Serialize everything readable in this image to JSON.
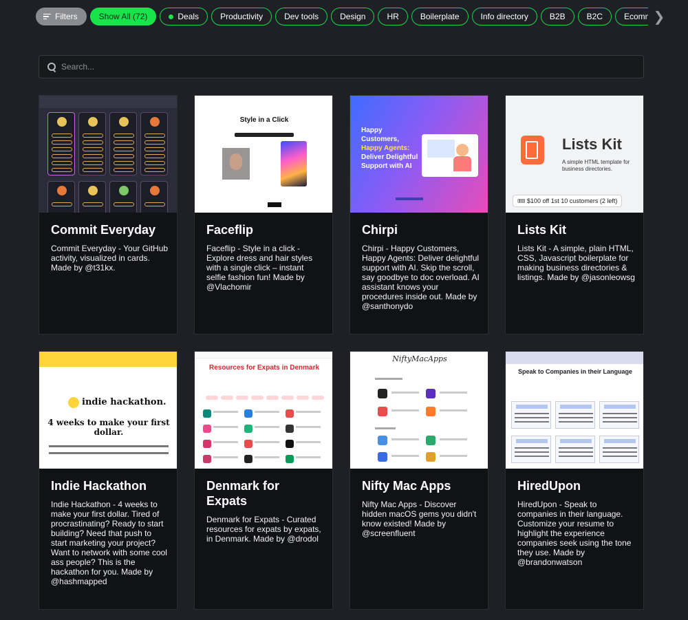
{
  "filters": {
    "filters_label": "Filters",
    "show_all_label": "Show All (72)",
    "categories": [
      "Deals",
      "Productivity",
      "Dev tools",
      "Design",
      "HR",
      "Boilerplate",
      "Info directory",
      "B2B",
      "B2C",
      "Ecommerce"
    ]
  },
  "search": {
    "placeholder": "Search..."
  },
  "cards": [
    {
      "title": "Commit Everyday",
      "description": "Commit Everyday - Your GitHub activity, visualized in cards. Made by @t31kx."
    },
    {
      "title": "Faceflip",
      "description": "Faceflip - Style in a click - Explore dress and hair styles with a single click – instant selfie fashion fun! Made by @Vlachomir",
      "thumb_heading": "Style in a Click"
    },
    {
      "title": "Chirpi",
      "description": "Chirpi - Happy Customers, Happy Agents: Deliver delightful support with AI. Skip the scroll, say goodbye to doc overload. AI assistant knows your procedures inside out. Made by @santhonydo",
      "thumb_text": [
        "Happy",
        "Customers,",
        "Happy Agents:",
        "Deliver Delightful",
        "Support with AI"
      ]
    },
    {
      "title": "Lists Kit",
      "description": "Lists Kit - A simple, plain HTML, CSS, Javascript boilerplate for making business directories & listings. Made by @jasonleowsg",
      "thumb_name": "Lists Kit",
      "thumb_sub": "A simple HTML template for business directories.",
      "thumb_promo": "🎟 $100 off 1st 10 customers (2 left)"
    },
    {
      "title": "Indie Hackathon",
      "description": "Indie Hackathon - 4 weeks to make your first dollar. Tired of procrastinating? Ready to start building? Need that push to start marketing your project? Want to network with some cool ass people? This is the hackathon for you. Made by @hashmapped",
      "thumb_logo": "indie hackathon.",
      "thumb_big": "4 weeks to make your first dollar."
    },
    {
      "title": "Denmark for Expats",
      "description": "Denmark for Expats - Curated resources for expats by expats, in Denmark. Made by @drodol",
      "thumb_heading": "Resources for Expats in Denmark"
    },
    {
      "title": "Nifty Mac Apps",
      "description": "Nifty Mac Apps - Discover hidden macOS gems you didn't know existed! Made by @screenfluent",
      "thumb_heading": "NiftyMacApps"
    },
    {
      "title": "HiredUpon",
      "description": "HiredUpon - Speak to companies in their language. Customize your resume to highlight the experience companies seek using the tone they use. Made by @brandonwatson",
      "thumb_heading": "Speak to Companies in their Language"
    }
  ],
  "colors": {
    "accent": "#19e34b",
    "background": "#1f2026",
    "card": "#111216"
  }
}
